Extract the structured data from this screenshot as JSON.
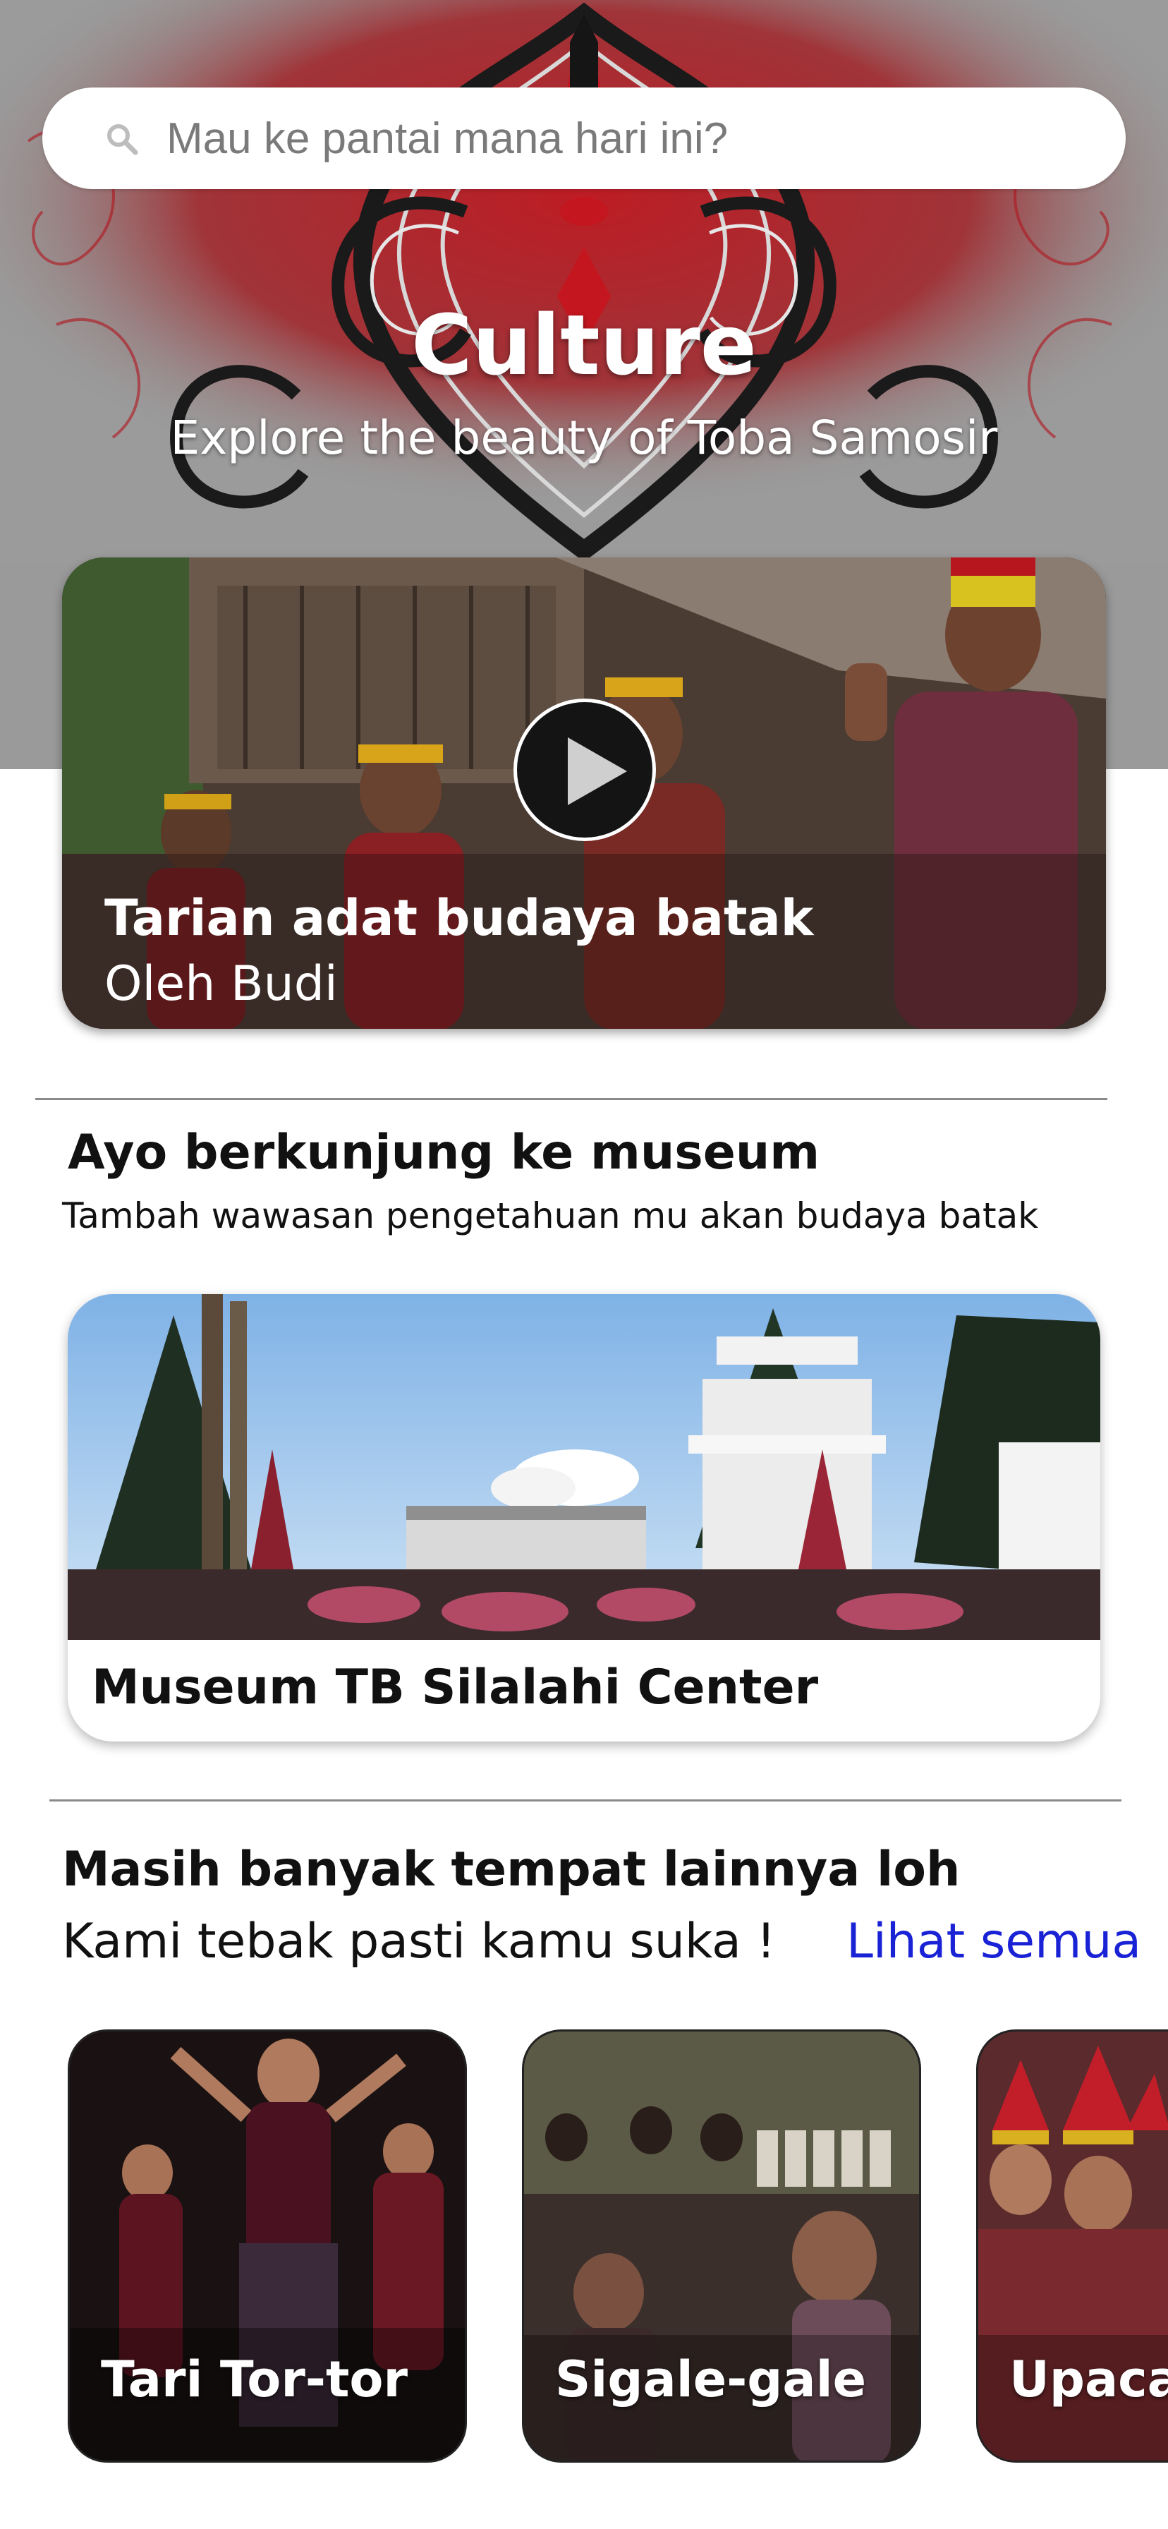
{
  "search": {
    "placeholder": "Mau ke pantai mana hari ini?"
  },
  "hero": {
    "title": "Culture",
    "subtitle": "Explore the beauty of Toba Samosir"
  },
  "video": {
    "title": "Tarian adat budaya batak",
    "author": "Oleh Budi"
  },
  "museum_section": {
    "title": "Ayo berkunjung ke museum",
    "subtitle": "Tambah wawasan pengetahuan mu akan budaya batak",
    "card_name": "Museum TB Silalahi Center"
  },
  "more_section": {
    "title": "Masih banyak tempat lainnya loh",
    "subtitle": "Kami tebak pasti kamu suka !",
    "see_all": "Lihat semua",
    "items": [
      {
        "label": "Tari Tor-tor"
      },
      {
        "label": "Sigale-gale"
      },
      {
        "label": "Upaca"
      }
    ]
  },
  "colors": {
    "accent_link": "#1a22d6",
    "hero_red": "#b0141c",
    "hero_gray": "#9a9a9a"
  }
}
